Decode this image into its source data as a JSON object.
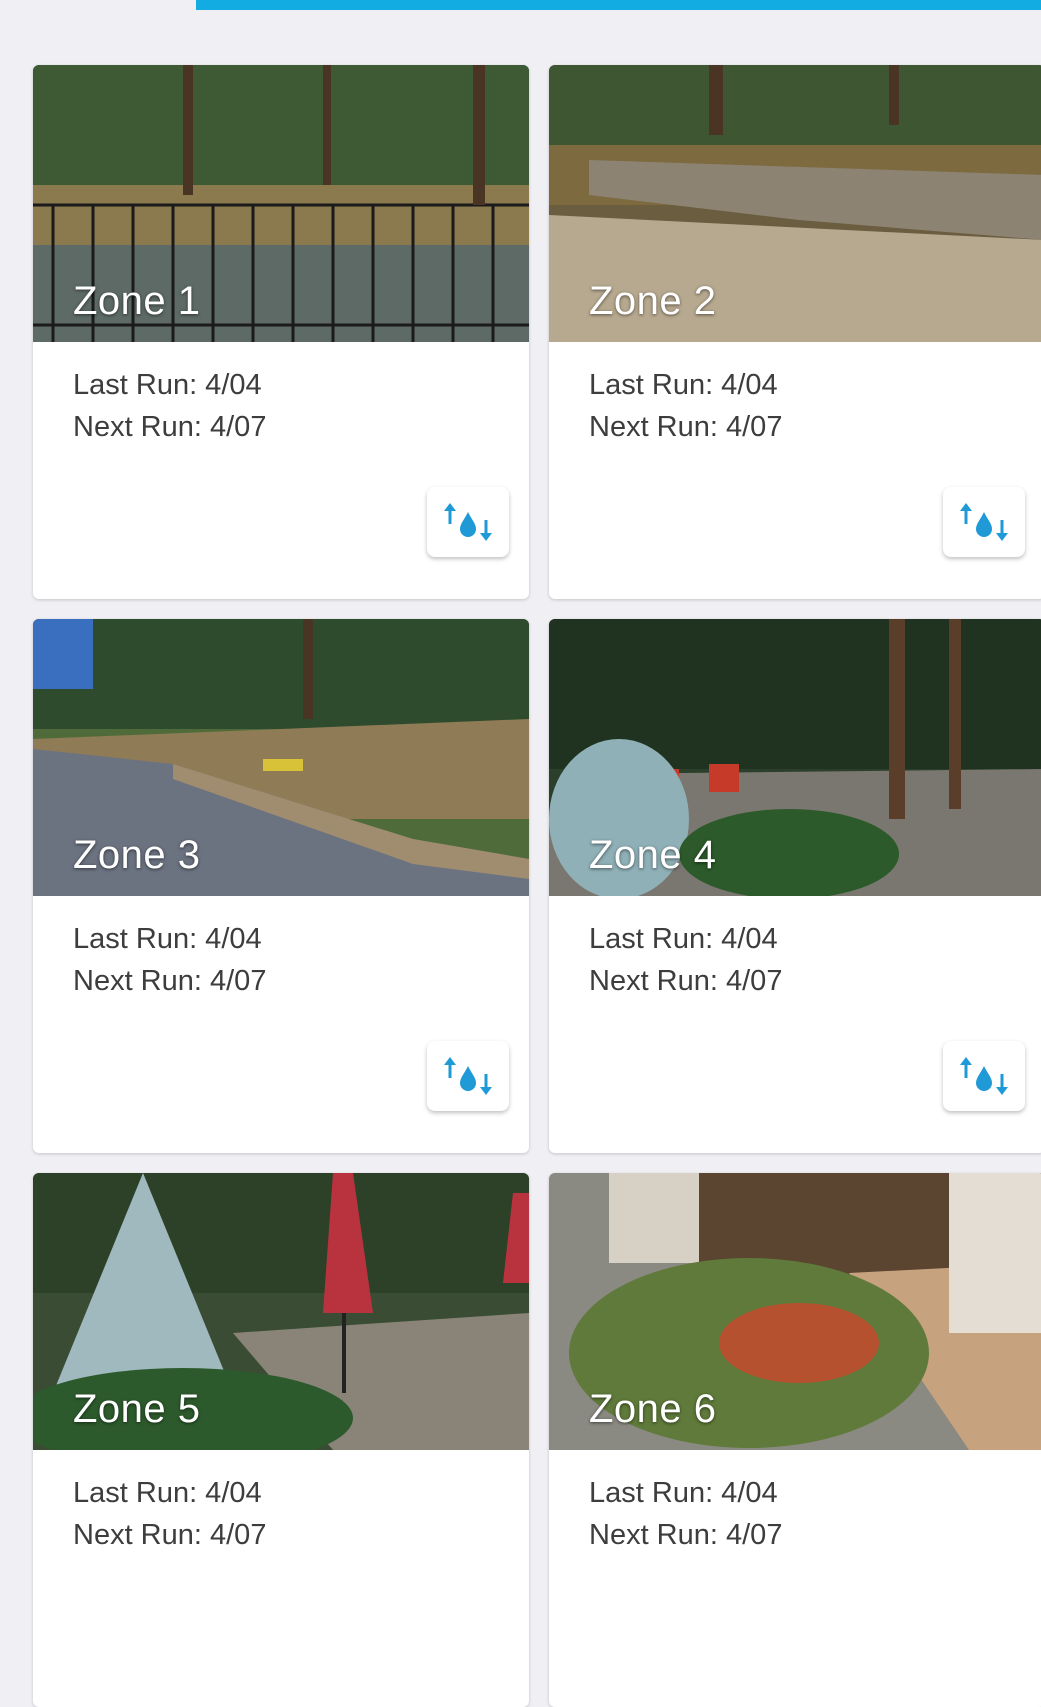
{
  "zones": [
    {
      "name": "Zone 1",
      "last_run": "Last Run: 4/04",
      "next_run": "Next Run: 4/07"
    },
    {
      "name": "Zone 2",
      "last_run": "Last Run: 4/04",
      "next_run": "Next Run: 4/07"
    },
    {
      "name": "Zone 3",
      "last_run": "Last Run: 4/04",
      "next_run": "Next Run: 4/07"
    },
    {
      "name": "Zone 4",
      "last_run": "Last Run: 4/04",
      "next_run": "Next Run: 4/07"
    },
    {
      "name": "Zone 5",
      "last_run": "Last Run: 4/04",
      "next_run": "Next Run: 4/07"
    },
    {
      "name": "Zone 6",
      "last_run": "Last Run: 4/04",
      "next_run": "Next Run: 4/07"
    }
  ],
  "icons": {
    "water_adjust": "water-drop-up-down-arrows-icon"
  },
  "colors": {
    "accent": "#12ace3",
    "icon": "#1f9ad6",
    "background": "#efeff4"
  }
}
